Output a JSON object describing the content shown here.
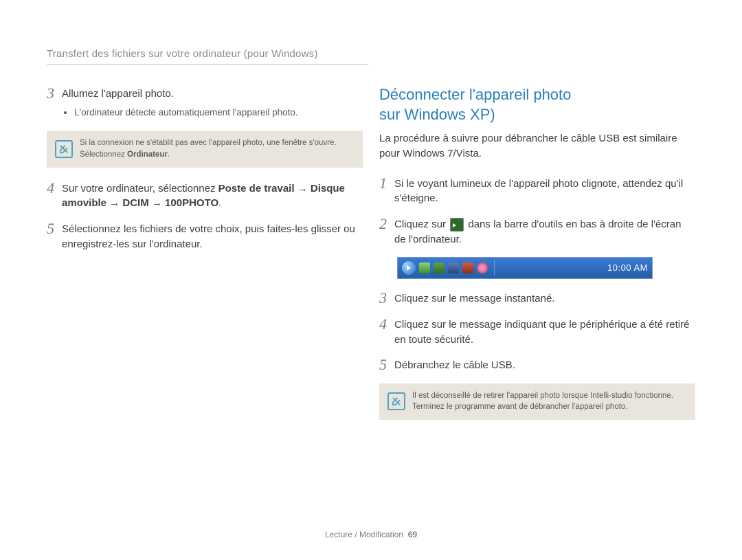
{
  "header": {
    "title": "Transfert des fichiers sur votre ordinateur (pour Windows)"
  },
  "left": {
    "step3": {
      "num": "3",
      "text": "Allumez l'appareil photo.",
      "bullet": "L'ordinateur détecte automatiquement l'appareil photo."
    },
    "note": {
      "line1": "Si la connexion ne s'établit pas avec l'appareil photo, une fenêtre s'ouvre.",
      "line2_pre": "Sélectionnez ",
      "line2_bold": "Ordinateur",
      "line2_post": "."
    },
    "step4": {
      "num": "4",
      "part1": "Sur votre ordinateur, sélectionnez ",
      "bold1": "Poste de travail",
      "arrow": " → ",
      "bold2": "Disque amovible",
      "bold3": "DCIM",
      "bold4": "100PHOTO",
      "end": "."
    },
    "step5": {
      "num": "5",
      "text": "Sélectionnez les fichiers de votre choix, puis faites-les glisser ou enregistrez-les sur l'ordinateur."
    }
  },
  "right": {
    "title_line1": "Déconnecter l'appareil photo",
    "title_line2": "sur Windows XP)",
    "intro": "La procédure à suivre pour débrancher le câble USB est similaire pour Windows 7/Vista.",
    "step1": {
      "num": "1",
      "text": "Si le voyant lumineux de l'appareil photo clignote, attendez qu'il s'éteigne."
    },
    "step2": {
      "num": "2",
      "pre": "Cliquez sur ",
      "post": " dans la barre d'outils en bas à droite de l'écran de l'ordinateur."
    },
    "taskbar": {
      "clock": "10:00 AM"
    },
    "step3": {
      "num": "3",
      "text": "Cliquez sur le message instantané."
    },
    "step4": {
      "num": "4",
      "text": "Cliquez sur le message indiquant que le périphérique a été retiré en toute sécurité."
    },
    "step5": {
      "num": "5",
      "text": "Débranchez le câble USB."
    },
    "note": {
      "line1": "Il est déconseillé de retirer l'appareil photo lorsque Intelli-studio fonctionne.",
      "line2": "Terminez le programme avant de débrancher l'appareil photo."
    }
  },
  "footer": {
    "section": "Lecture / Modification",
    "page": "69"
  }
}
